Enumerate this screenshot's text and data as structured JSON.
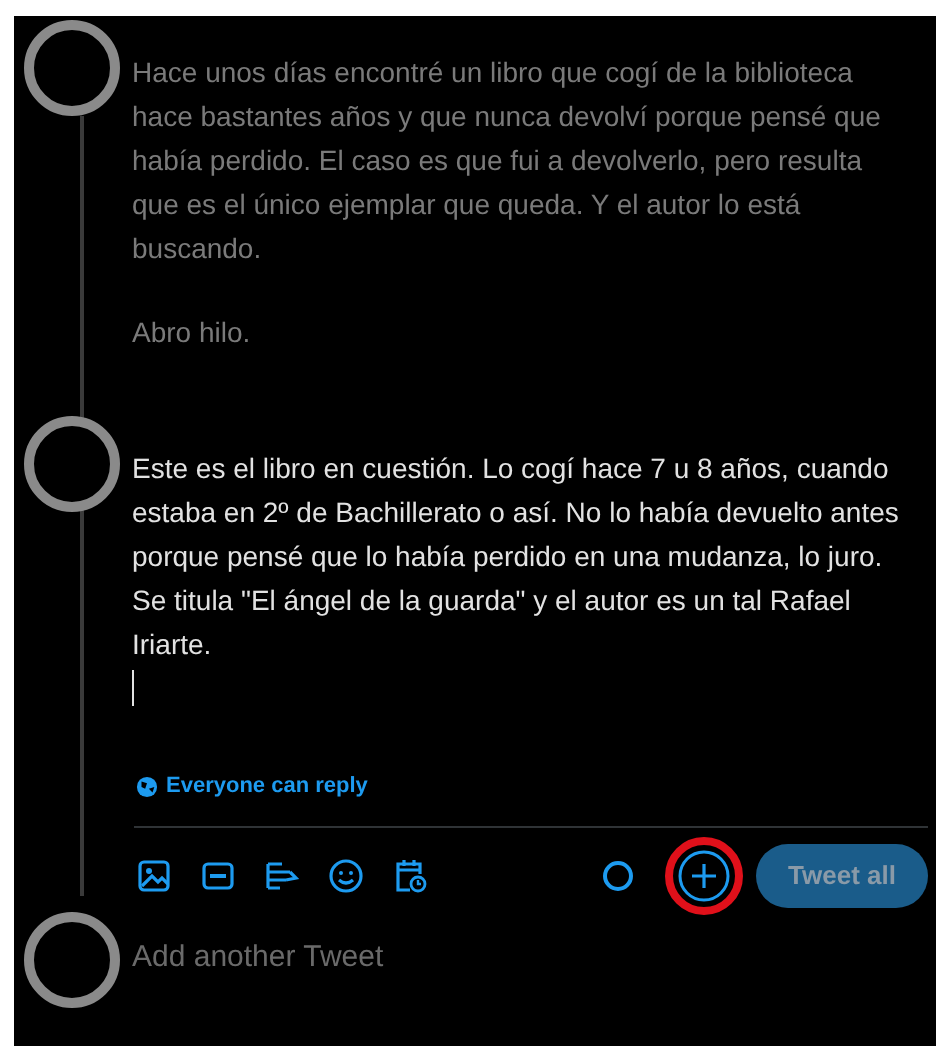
{
  "thread": [
    {
      "paragraphs": [
        "Hace unos días encontré un libro que cogí de la biblioteca hace bastantes años y que nunca devolví porque pensé que había perdido. El caso es que fui a devolverlo, pero resulta que es el único ejemplar que queda. Y el autor lo está buscando.",
        "Abro hilo."
      ],
      "active": false
    },
    {
      "paragraphs": [
        "Este es el libro en cuestión. Lo cogí hace 7 u 8 años, cuando estaba en 2º de Bachillerato o así. No lo había devuelto antes porque pensé que lo había perdido en una mudanza, lo juro. Se titula \"El ángel de la guarda\" y el autor es un tal Rafael Iriarte."
      ],
      "active": true
    }
  ],
  "reply_setting": "Everyone can reply",
  "tweet_all": {
    "label": "Tweet all",
    "disabled": true
  },
  "add_tweet": {
    "placeholder": "Add another Tweet"
  }
}
